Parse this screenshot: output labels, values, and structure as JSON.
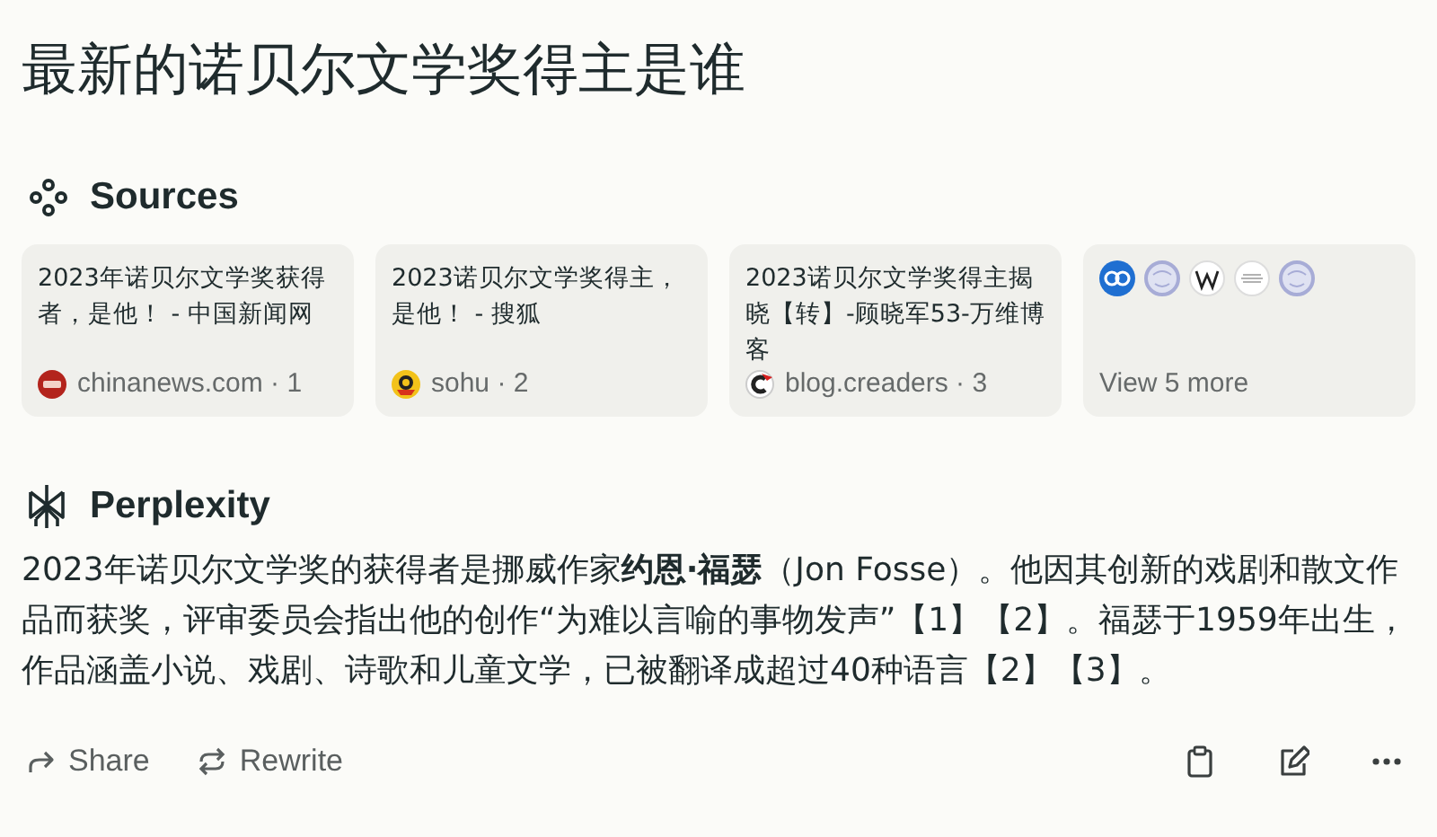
{
  "query": "最新的诺贝尔文学奖得主是谁",
  "sources": {
    "heading": "Sources",
    "items": [
      {
        "title": "2023年诺贝尔文学奖获得者，是他！ - 中国新闻网",
        "site": "chinanews.com · 1"
      },
      {
        "title": "2023诺贝尔文学奖得主，是他！ - 搜狐",
        "site": "sohu · 2"
      },
      {
        "title": "2023诺贝尔文学奖得主揭晓【转】-顾晓军53-万维博客",
        "site": "blog.creaders · 3"
      }
    ],
    "more": "View 5 more"
  },
  "answer": {
    "heading": "Perplexity",
    "text": "2023年诺贝尔文学奖的获得者是挪威作家**约恩·福瑟**（Jon Fosse）。他因其创新的戏剧和散文作品而获奖，评审委员会指出他的创作“为难以言喻的事物发声”【1】【2】。福瑟于1959年出生，作品涵盖小说、戏剧、诗歌和儿童文学，已被翻译成超过40种语言【2】【3】。"
  },
  "actions": [
    {
      "label": "Share",
      "kind": "share"
    },
    {
      "label": "Rewrite",
      "kind": "rewrite"
    }
  ]
}
